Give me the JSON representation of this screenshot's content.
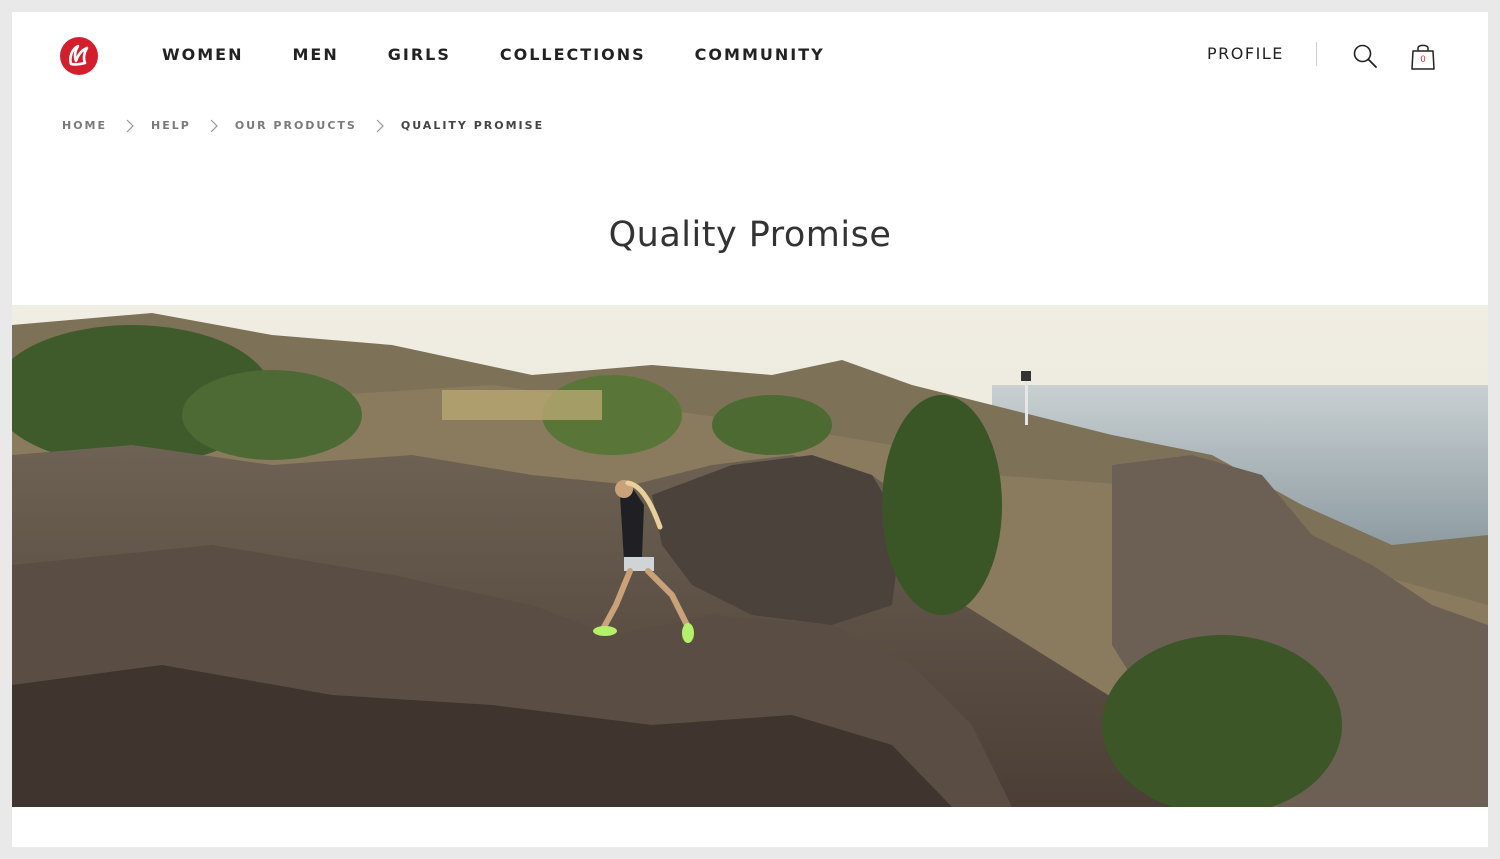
{
  "brand": {
    "logo_icon": "lululemon-logo-icon",
    "accent": "#d31f2d"
  },
  "nav": {
    "items": [
      {
        "label": "WOMEN"
      },
      {
        "label": "MEN"
      },
      {
        "label": "GIRLS"
      },
      {
        "label": "COLLECTIONS"
      },
      {
        "label": "COMMUNITY"
      }
    ]
  },
  "utility": {
    "profile_label": "PROFILE",
    "search_icon": "search-icon",
    "bag_icon": "shopping-bag-icon",
    "bag_count": "0"
  },
  "breadcrumb": {
    "items": [
      {
        "label": "HOME"
      },
      {
        "label": "HELP"
      },
      {
        "label": "OUR PRODUCTS"
      },
      {
        "label": "QUALITY PROMISE"
      }
    ]
  },
  "page": {
    "title": "Quality Promise"
  },
  "hero": {
    "image": "woman-running-on-coastal-cliff-trail"
  }
}
